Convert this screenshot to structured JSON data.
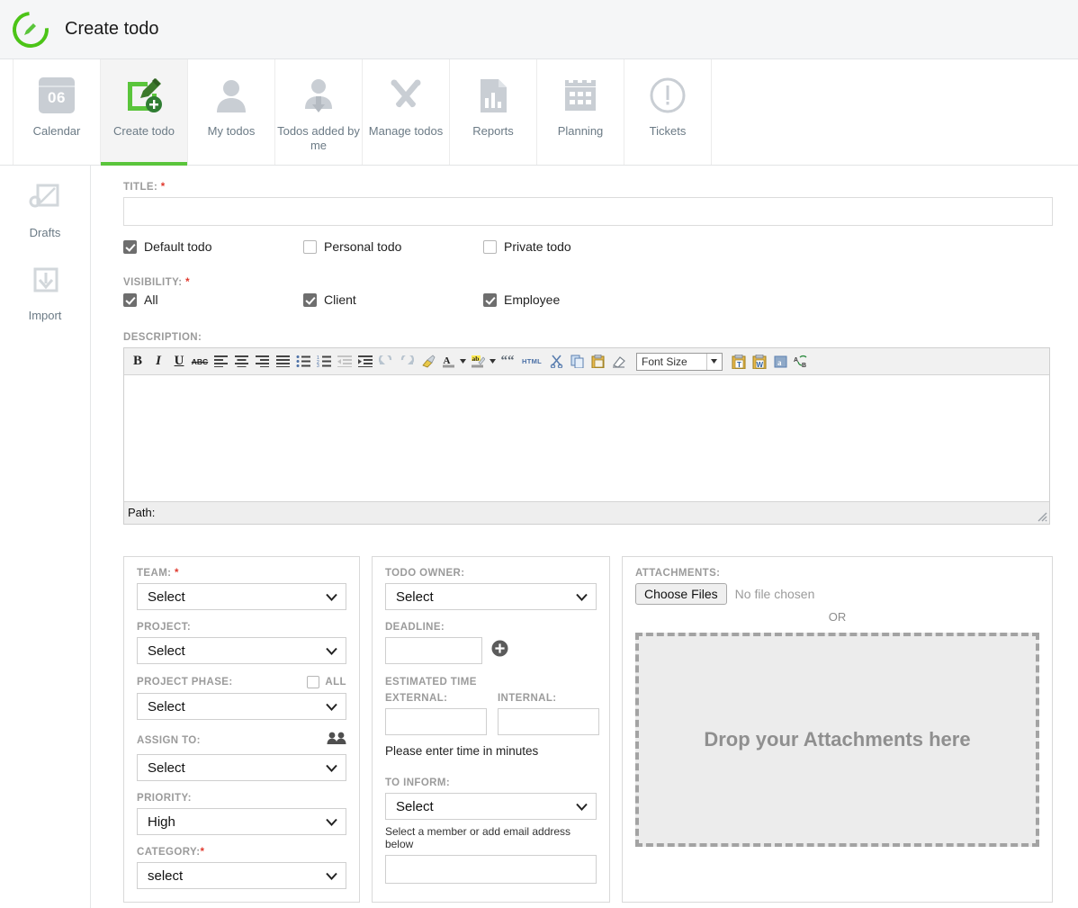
{
  "header": {
    "title": "Create todo",
    "logo_icon": "green-circle-pencil-logo"
  },
  "tabs": [
    {
      "label": "Calendar",
      "icon": "calendar-icon",
      "badge": "06",
      "active": false
    },
    {
      "label": "Create todo",
      "icon": "create-todo-pencil-icon",
      "active": true
    },
    {
      "label": "My todos",
      "icon": "user-icon",
      "active": false
    },
    {
      "label": "Todos added by me",
      "icon": "user-download-icon",
      "active": false
    },
    {
      "label": "Manage todos",
      "icon": "tools-wrench-screwdriver-icon",
      "active": false
    },
    {
      "label": "Reports",
      "icon": "document-chart-icon",
      "active": false
    },
    {
      "label": "Planning",
      "icon": "calendar-grid-icon",
      "active": false
    },
    {
      "label": "Tickets",
      "icon": "exclamation-circle-icon",
      "active": false
    }
  ],
  "sidebar": {
    "items": [
      {
        "label": "Drafts",
        "icon": "drafts-icon"
      },
      {
        "label": "Import",
        "icon": "import-icon"
      }
    ]
  },
  "form": {
    "title_label": "TITLE:",
    "title_value": "",
    "required_mark": "*",
    "todo_types": [
      {
        "label": "Default todo",
        "checked": true
      },
      {
        "label": "Personal todo",
        "checked": false
      },
      {
        "label": "Private todo",
        "checked": false
      }
    ],
    "visibility_label": "VISIBILITY:",
    "visibility": [
      {
        "label": "All",
        "checked": true
      },
      {
        "label": "Client",
        "checked": true
      },
      {
        "label": "Employee",
        "checked": true
      }
    ],
    "description_label": "DESCRIPTION:"
  },
  "editor": {
    "toolbar": [
      {
        "name": "bold-icon",
        "glyph": "B"
      },
      {
        "name": "italic-icon",
        "glyph": "I"
      },
      {
        "name": "underline-icon",
        "glyph": "U"
      },
      {
        "name": "strikethrough-abc-icon",
        "glyph": "ABC"
      },
      {
        "name": "align-left-icon"
      },
      {
        "name": "align-center-icon"
      },
      {
        "name": "align-right-icon"
      },
      {
        "name": "align-justify-icon"
      },
      {
        "name": "bullet-list-icon"
      },
      {
        "name": "numbered-list-icon"
      },
      {
        "name": "outdent-icon"
      },
      {
        "name": "indent-icon"
      },
      {
        "name": "undo-icon"
      },
      {
        "name": "redo-icon"
      },
      {
        "name": "format-painter-broom-icon"
      },
      {
        "name": "text-color-icon",
        "glyph": "A"
      },
      {
        "name": "highlight-color-icon",
        "glyph": "ab"
      },
      {
        "name": "blockquote-icon",
        "glyph": "““"
      },
      {
        "name": "html-source-icon",
        "glyph": "HTML"
      },
      {
        "name": "cut-scissors-icon"
      },
      {
        "name": "copy-icon"
      },
      {
        "name": "paste-icon"
      },
      {
        "name": "eraser-icon"
      },
      {
        "name": "paste-as-text-icon"
      },
      {
        "name": "paste-from-word-icon"
      },
      {
        "name": "spell-check-icon",
        "glyph": "a"
      },
      {
        "name": "find-replace-icon",
        "glyph": "A→B"
      }
    ],
    "font_size_label": "Font Size",
    "content": "",
    "path_label": "Path:"
  },
  "panel_team": {
    "team_label": "TEAM:",
    "team_value": "Select",
    "project_label": "PROJECT:",
    "project_value": "Select",
    "project_phase_label": "PROJECT PHASE:",
    "project_phase_all_label": "ALL",
    "project_phase_all_checked": false,
    "project_phase_value": "Select",
    "assign_to_label": "ASSIGN TO:",
    "assign_to_icon": "group-people-icon",
    "assign_to_value": "Select",
    "priority_label": "PRIORITY:",
    "priority_value": "High",
    "category_label": "CATEGORY:",
    "category_value": "select"
  },
  "panel_owner": {
    "todo_owner_label": "TODO OWNER:",
    "todo_owner_value": "Select",
    "deadline_label": "DEADLINE:",
    "deadline_value": "",
    "deadline_add_icon": "plus-circle-icon",
    "estimated_time_label": "ESTIMATED TIME",
    "external_label": "EXTERNAL:",
    "external_value": "",
    "internal_label": "INTERNAL:",
    "internal_value": "",
    "time_hint": "Please enter time in minutes",
    "to_inform_label": "TO INFORM:",
    "to_inform_value": "Select",
    "to_inform_hint": "Select a member or add email address below",
    "email_value": ""
  },
  "panel_attachments": {
    "attachments_label": "ATTACHMENTS:",
    "choose_files_label": "Choose Files",
    "no_file_text": "No file chosen",
    "or_text": "OR",
    "dropzone_text": "Drop your Attachments here"
  },
  "colors": {
    "brand_green": "#5ac53b",
    "required_red": "#e03a2f",
    "icon_gray": "#c9ced4",
    "label_gray": "#9b9b9b"
  }
}
